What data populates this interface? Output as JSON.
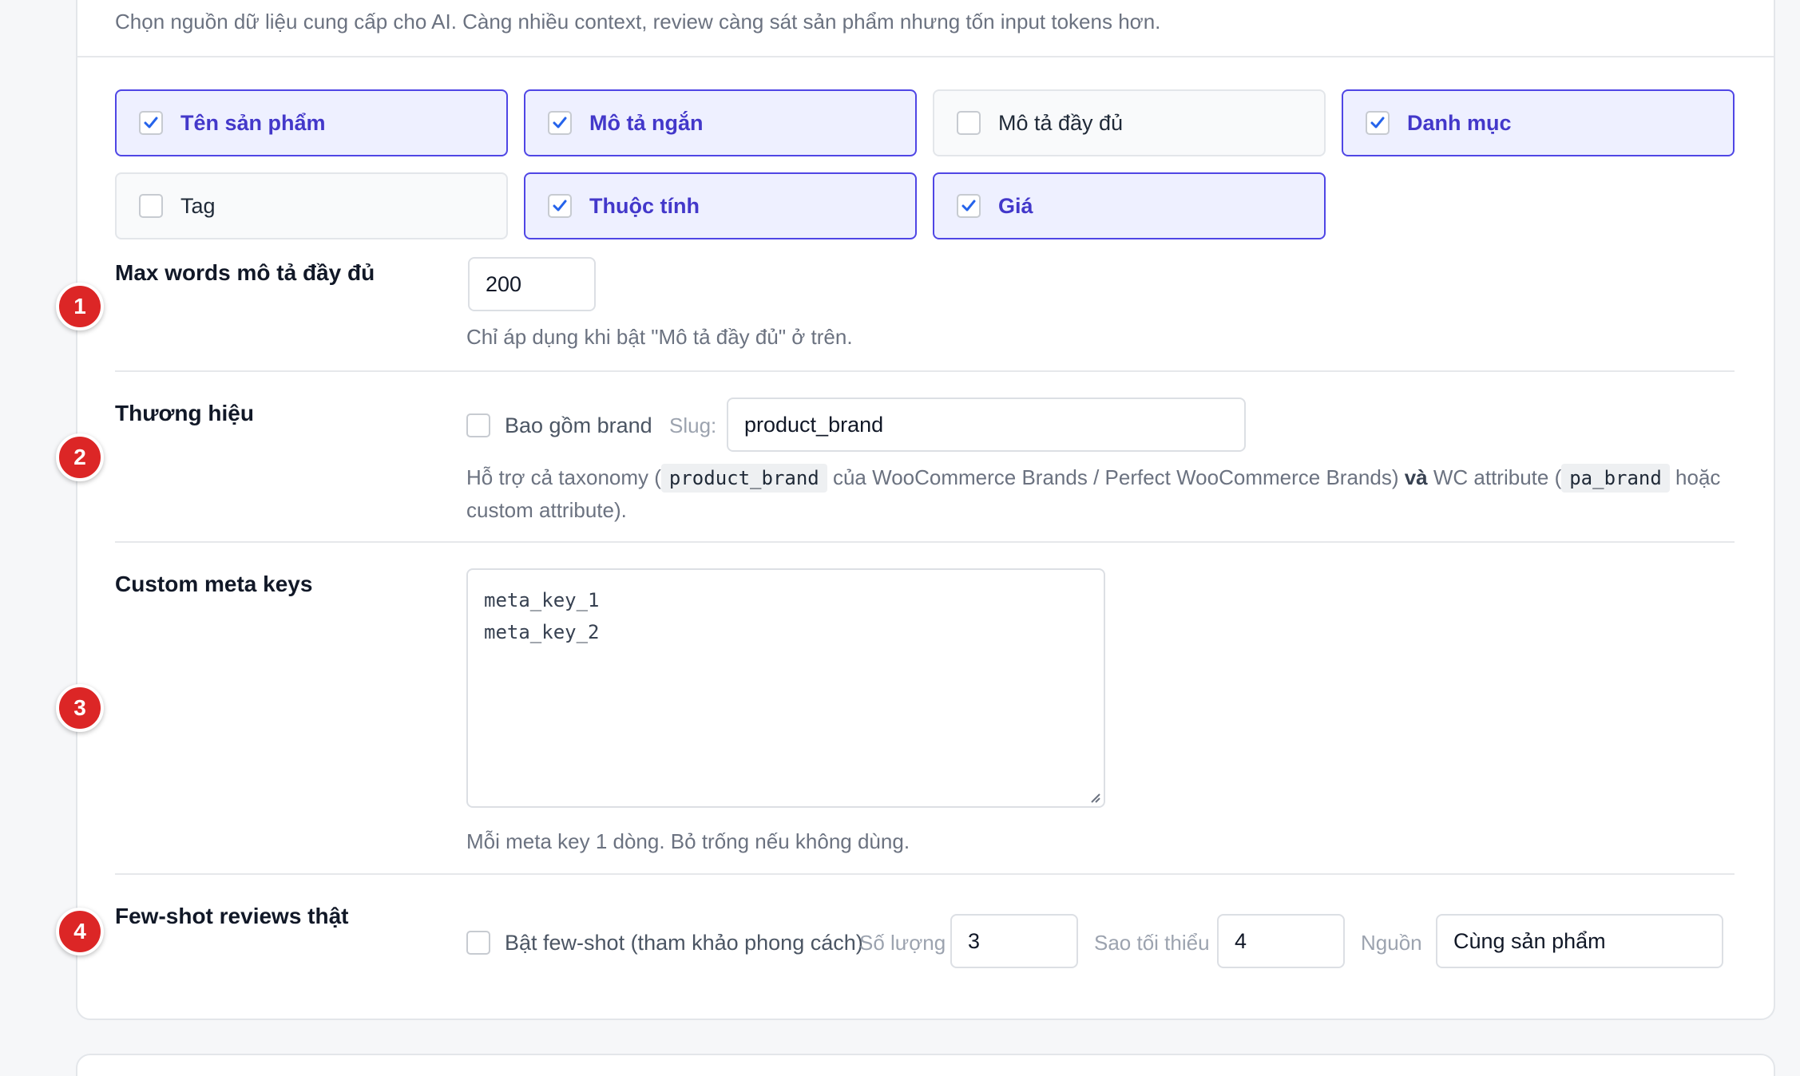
{
  "intro_text": "Chọn nguồn dữ liệu cung cấp cho AI. Càng nhiều context, review càng sát sản phẩm nhưng tốn input tokens hơn.",
  "sources": [
    {
      "label": "Tên sản phẩm",
      "checked": true
    },
    {
      "label": "Mô tả ngắn",
      "checked": true
    },
    {
      "label": "Mô tả đầy đủ",
      "checked": false
    },
    {
      "label": "Danh mục",
      "checked": true
    },
    {
      "label": "Tag",
      "checked": false
    },
    {
      "label": "Thuộc tính",
      "checked": true
    },
    {
      "label": "Giá",
      "checked": true
    }
  ],
  "max_words": {
    "badge": "1",
    "label": "Max words mô tả đầy đủ",
    "value": "200",
    "help": "Chỉ áp dụng khi bật \"Mô tả đầy đủ\" ở trên."
  },
  "brand": {
    "badge": "2",
    "label": "Thương hiệu",
    "checkbox_label": "Bao gồm brand",
    "slug_label": "Slug:",
    "slug_value": "product_brand",
    "help_1": "Hỗ trợ cả taxonomy (",
    "help_code_1": "product_brand",
    "help_2": " của WooCommerce Brands / Perfect WooCommerce Brands) ",
    "help_bold": "và",
    "help_3": " WC attribute (",
    "help_code_2": "pa_brand",
    "help_4": " hoặc",
    "help_5": "custom attribute)."
  },
  "meta": {
    "badge": "3",
    "label": "Custom meta keys",
    "line_1": "meta_key_1",
    "line_2": "meta_key_2",
    "help": "Mỗi meta key 1 dòng. Bỏ trống nếu không dùng."
  },
  "fewshot": {
    "badge": "4",
    "label": "Few-shot reviews thật",
    "checkbox_label": "Bật few-shot (tham khảo phong cách)",
    "count_label": "Số lượng",
    "count_value": "3",
    "min_star_label": "Sao tối thiểu",
    "min_star_value": "4",
    "source_label": "Nguồn",
    "source_value": "Cùng sản phẩm"
  },
  "colors": {
    "accent": "#4f46e5",
    "checked_bg": "#eef0ff",
    "badge": "#dc2626"
  }
}
